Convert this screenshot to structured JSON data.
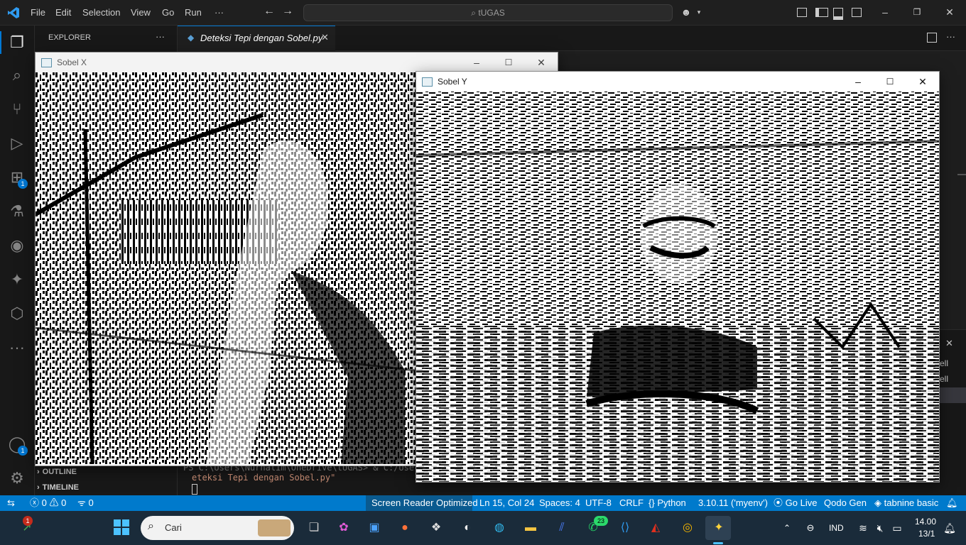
{
  "menubar": {
    "items": [
      "File",
      "Edit",
      "Selection",
      "View",
      "Go",
      "Run",
      "···"
    ],
    "search": "tUGAS"
  },
  "sidebar": {
    "title": "EXPLORER",
    "more": "···",
    "outline": "OUTLINE",
    "timeline": "TIMELINE"
  },
  "activity": {
    "extensions_badge": "1",
    "accounts_badge": "1"
  },
  "editor": {
    "tab_label": "Deteksi Tepi dengan Sobel.py"
  },
  "terminal": {
    "line1": "PS C:\\Users\\Nurhalim\\OneDrive\\tUGAS> & C:/Use",
    "line2": "eteksi Tepi dengan Sobel.py\"",
    "panel_snippet1": "ell",
    "panel_snippet2": "ell"
  },
  "windows": {
    "sobel_x": {
      "title": "Sobel X"
    },
    "sobel_y": {
      "title": "Sobel Y"
    }
  },
  "statusbar": {
    "errors": "0",
    "warnings": "0",
    "ports": "0",
    "screen_reader": "Screen Reader Optimized",
    "position": "Ln 15, Col 24",
    "spaces": "Spaces: 4",
    "encoding": "UTF-8",
    "eol": "CRLF",
    "language": "Python",
    "interpreter": "3.10.11 ('myenv')",
    "golive": "Go Live",
    "qodo": "Qodo Gen",
    "tabnine": "tabnine basic"
  },
  "taskbar": {
    "search_placeholder": "Cari",
    "whatsapp_badge": "23",
    "language": "IND",
    "time": "14.00",
    "date": "13/1",
    "notif_badge": "1"
  },
  "colors": {
    "accent": "#007acc",
    "activity_badge": "#0078d4",
    "taskbar": "#1a2b3a"
  }
}
